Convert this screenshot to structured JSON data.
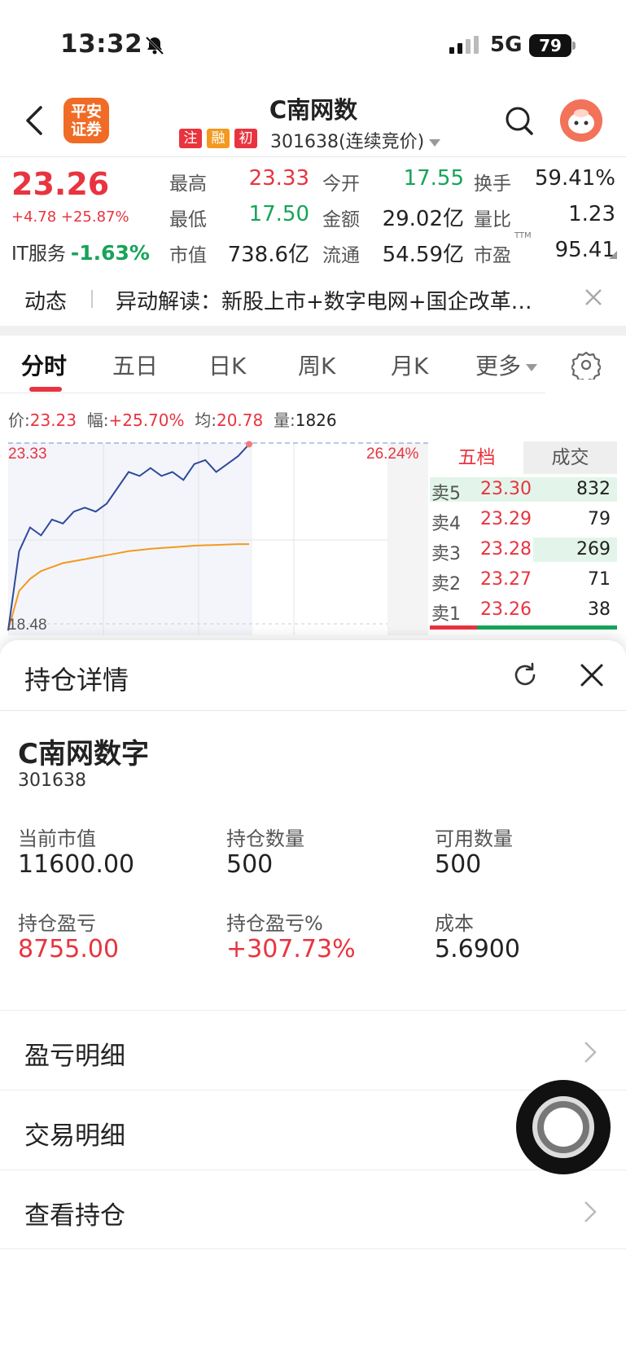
{
  "status_bar": {
    "time": "13:32",
    "network": "5G",
    "battery": "79"
  },
  "header": {
    "title": "C南网数",
    "logo_text": "平安证券",
    "tags": [
      {
        "text": "注",
        "color": "#e8343f"
      },
      {
        "text": "融",
        "color": "#f29a1f"
      },
      {
        "text": "初",
        "color": "#e8343f"
      }
    ],
    "code_line": "301638(连续竞价)"
  },
  "quote": {
    "price": "23.26",
    "change": "+4.78 +25.87%",
    "sector_label": "IT服务",
    "sector_change": "-1.63%",
    "rows": [
      [
        {
          "label": "最高",
          "value": "23.33",
          "color": "red"
        },
        {
          "label": "今开",
          "value": "17.55",
          "color": "green"
        },
        {
          "label": "换手",
          "value": "59.41%",
          "color": ""
        }
      ],
      [
        {
          "label": "最低",
          "value": "17.50",
          "color": "green"
        },
        {
          "label": "金额",
          "value": "29.02亿",
          "color": ""
        },
        {
          "label": "量比",
          "value": "1.23",
          "color": ""
        }
      ],
      [
        {
          "label": "市值",
          "value": "738.6亿",
          "color": ""
        },
        {
          "label": "流通",
          "value": "54.59亿",
          "color": ""
        },
        {
          "label": "市盈",
          "value": "95.41",
          "color": ""
        }
      ]
    ],
    "ttm_label": "TTM"
  },
  "news": {
    "tag": "动态",
    "text": "异动解读：新股上市+数字电网+国企改革…"
  },
  "tabs": [
    "分时",
    "五日",
    "日K",
    "周K",
    "月K",
    "更多"
  ],
  "chart_info": {
    "price_label": "价:",
    "price": "23.23",
    "amp_label": "幅:",
    "amp": "+25.70%",
    "avg_label": "均:",
    "avg": "20.78",
    "vol_label": "量:",
    "vol": "1826"
  },
  "chart_data": {
    "type": "line",
    "ylim": [
      18.48,
      23.33
    ],
    "y_top_label": "23.33",
    "y_bottom_label": "18.48",
    "right_top_label": "26.24%",
    "series": [
      {
        "values": [
          18.6,
          20.6,
          21.2,
          21.0,
          21.4,
          21.3,
          21.6,
          21.7,
          21.6,
          21.8,
          22.2,
          22.6,
          22.5,
          22.7,
          22.5,
          22.6,
          22.4,
          22.8,
          22.9,
          22.6,
          22.8,
          23.0,
          23.3
        ]
      },
      {
        "values": [
          18.6,
          19.6,
          19.9,
          20.1,
          20.2,
          20.3,
          20.35,
          20.4,
          20.45,
          20.5,
          20.55,
          20.6,
          20.63,
          20.66,
          20.68,
          20.7,
          20.72,
          20.74,
          20.75,
          20.76,
          20.77,
          20.78,
          20.78
        ]
      }
    ]
  },
  "order_book": {
    "tabs": [
      "五档",
      "成交"
    ],
    "rows": [
      {
        "label": "卖5",
        "price": "23.30",
        "qty": "832",
        "bar": 1.0
      },
      {
        "label": "卖4",
        "price": "23.29",
        "qty": "79",
        "bar": 0.0
      },
      {
        "label": "卖3",
        "price": "23.28",
        "qty": "269",
        "bar": 0.45
      },
      {
        "label": "卖2",
        "price": "23.27",
        "qty": "71",
        "bar": 0.0
      },
      {
        "label": "卖1",
        "price": "23.26",
        "qty": "38",
        "bar": 0.0
      }
    ]
  },
  "position": {
    "title": "持仓详情",
    "name": "C南网数字",
    "code": "301638",
    "fields": [
      {
        "label": "当前市值",
        "value": "11600.00",
        "color": ""
      },
      {
        "label": "持仓数量",
        "value": "500",
        "color": ""
      },
      {
        "label": "可用数量",
        "value": "500",
        "color": ""
      },
      {
        "label": "持仓盈亏",
        "value": "8755.00",
        "color": "red"
      },
      {
        "label": "持仓盈亏%",
        "value": "+307.73%",
        "color": "red"
      },
      {
        "label": "成本",
        "value": "5.6900",
        "color": ""
      }
    ],
    "menu": [
      "盈亏明细",
      "交易明细",
      "查看持仓"
    ]
  }
}
